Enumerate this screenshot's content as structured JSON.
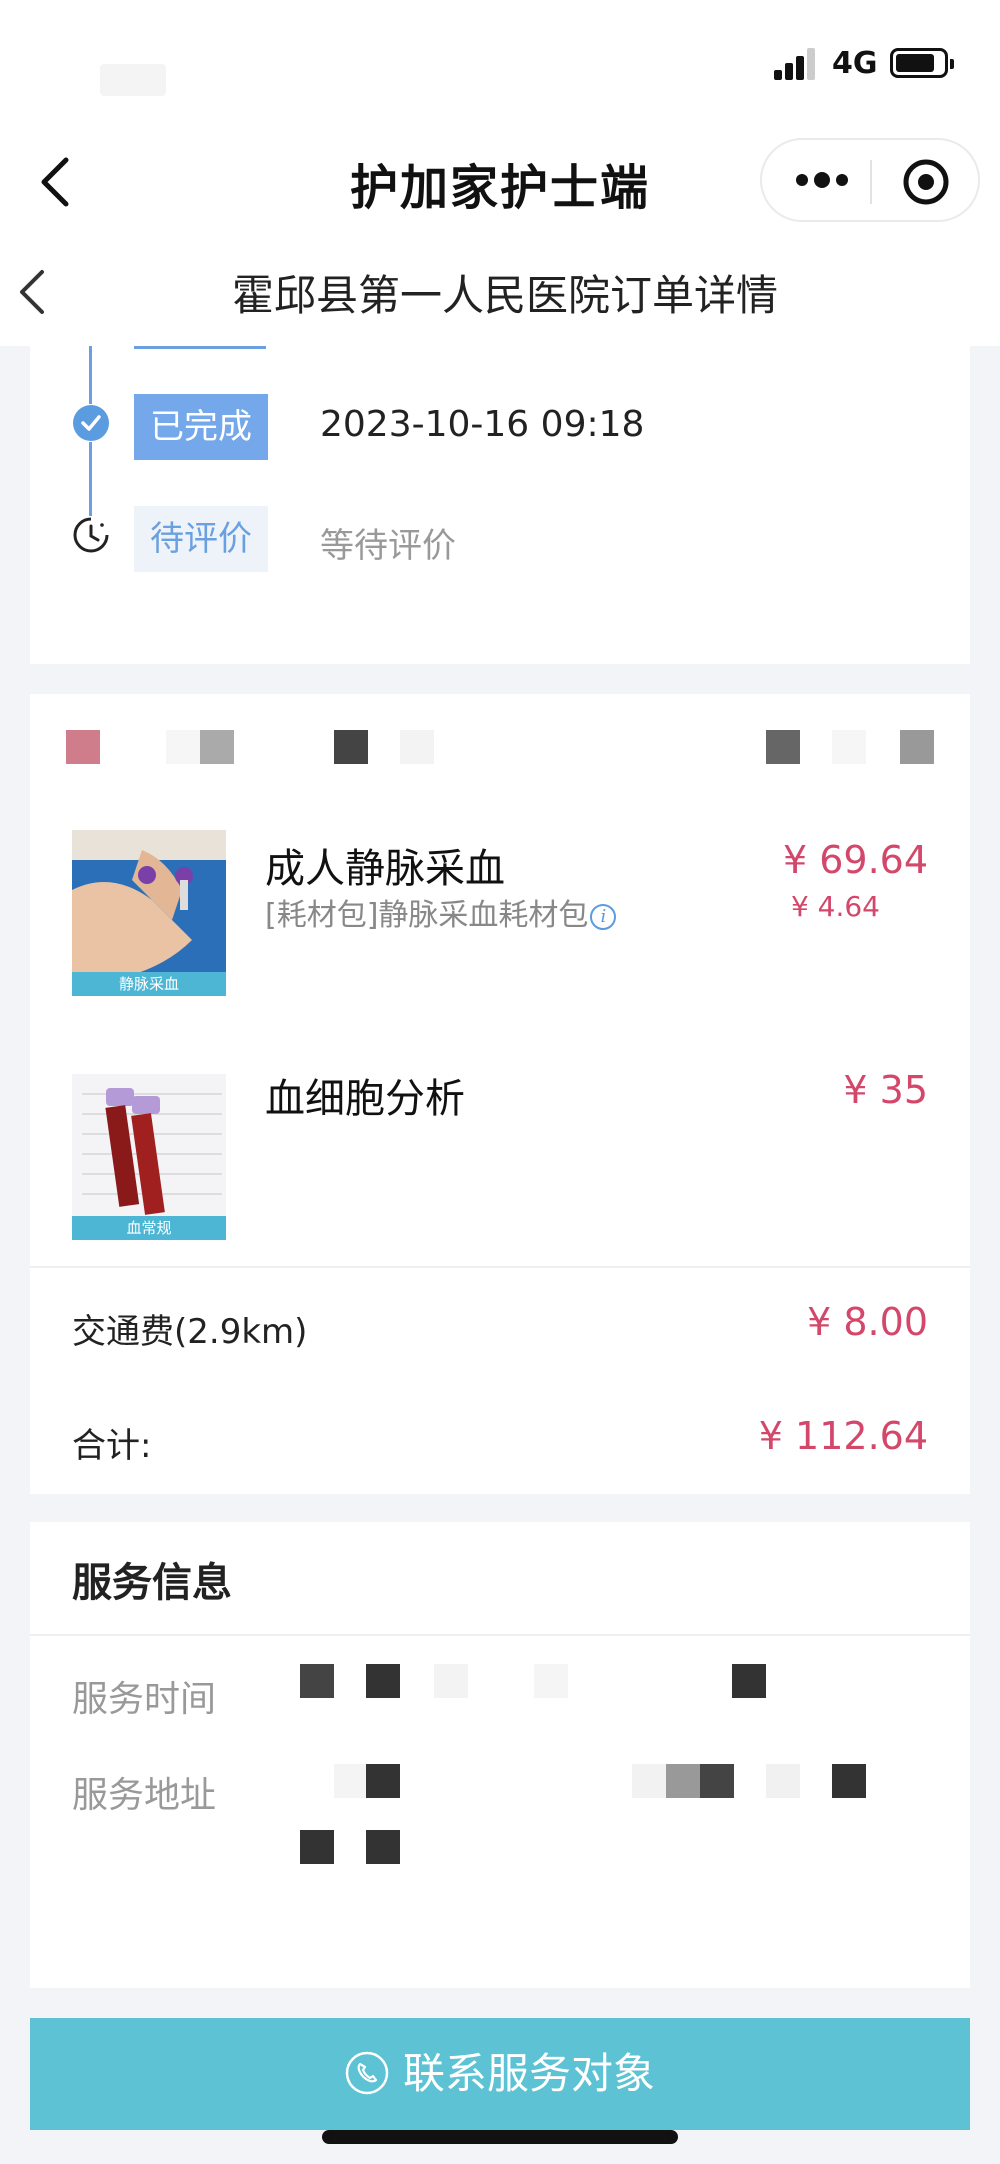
{
  "status_bar": {
    "network": "4G"
  },
  "nav": {
    "title": "护加家护士端"
  },
  "sub_header": {
    "title": "霍邱县第一人民医院订单详情"
  },
  "timeline": [
    {
      "tag": "已完成",
      "text": "2023-10-16 09:18",
      "state": "done"
    },
    {
      "tag": "待评价",
      "text": "等待评价",
      "state": "pending"
    }
  ],
  "items": [
    {
      "name": "成人静脉采血",
      "sub": "[耗材包]静脉采血耗材包",
      "price": "¥ 69.64",
      "sub_price": "¥ 4.64",
      "image_label": "静脉采血"
    },
    {
      "name": "血细胞分析",
      "price": "¥ 35",
      "image_label": "血常规"
    }
  ],
  "fees": {
    "transport_label": "交通费(2.9km)",
    "transport_value": "¥ 8.00",
    "total_label": "合计:",
    "total_value": "¥ 112.64"
  },
  "service": {
    "title": "服务信息",
    "time_label": "服务时间",
    "address_label": "服务地址"
  },
  "contact_button": {
    "label": "联系服务对象"
  },
  "colors": {
    "accent_blue": "#74a8ea",
    "price_red": "#d3476b",
    "button_teal": "#5cc2d4"
  }
}
